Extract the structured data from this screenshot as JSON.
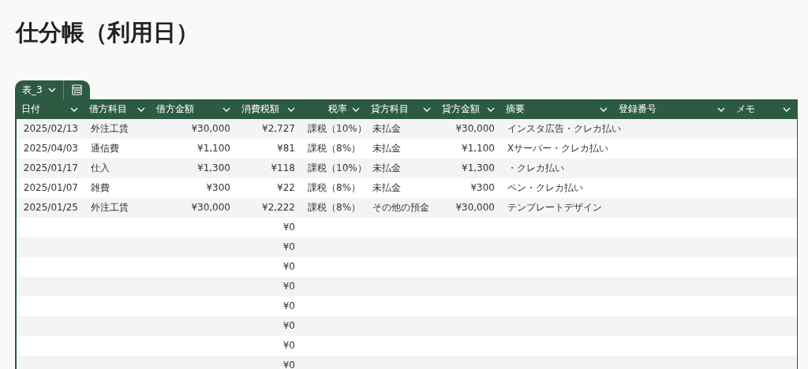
{
  "page": {
    "title": "仕分帳（利用日）"
  },
  "table_tab": {
    "label": "表_3"
  },
  "table": {
    "columns": [
      "日付",
      "借方科目",
      "借方金額",
      "消費税額",
      "税率",
      "貸方科目",
      "貸方金額",
      "摘要",
      "登録番号",
      "メモ"
    ],
    "rows": [
      {
        "date": "2025/02/13",
        "debit_account": "外注工賃",
        "debit_amount": "¥30,000",
        "tax_amount": "¥2,727",
        "tax_rate": "課税（10%）",
        "credit_account": "未払金",
        "credit_amount": "¥30,000",
        "description": "インスタ広告・クレカ払い"
      },
      {
        "date": "2025/04/03",
        "debit_account": "通信費",
        "debit_amount": "¥1,100",
        "tax_amount": "¥81",
        "tax_rate": "課税（8%）",
        "credit_account": "未払金",
        "credit_amount": "¥1,100",
        "description": "Xサーバー・クレカ払い"
      },
      {
        "date": "2025/01/17",
        "debit_account": "仕入",
        "debit_amount": "¥1,300",
        "tax_amount": "¥118",
        "tax_rate": "課税（10%）",
        "credit_account": "未払金",
        "credit_amount": "¥1,300",
        "description": "・クレカ払い"
      },
      {
        "date": "2025/01/07",
        "debit_account": "雑費",
        "debit_amount": "¥300",
        "tax_amount": "¥22",
        "tax_rate": "課税（8%）",
        "credit_account": "未払金",
        "credit_amount": "¥300",
        "description": "ペン・クレカ払い"
      },
      {
        "date": "2025/01/25",
        "debit_account": "外注工賃",
        "debit_amount": "¥30,000",
        "tax_amount": "¥2,222",
        "tax_rate": "課税（8%）",
        "credit_account": "その他の預金",
        "credit_amount": "¥30,000",
        "description": "テンプレートデザイン"
      },
      {
        "tax_amount": "¥0"
      },
      {
        "tax_amount": "¥0"
      },
      {
        "tax_amount": "¥0"
      },
      {
        "tax_amount": "¥0"
      },
      {
        "tax_amount": "¥0"
      },
      {
        "tax_amount": "¥0"
      },
      {
        "tax_amount": "¥0"
      },
      {
        "tax_amount": "¥0"
      }
    ]
  }
}
